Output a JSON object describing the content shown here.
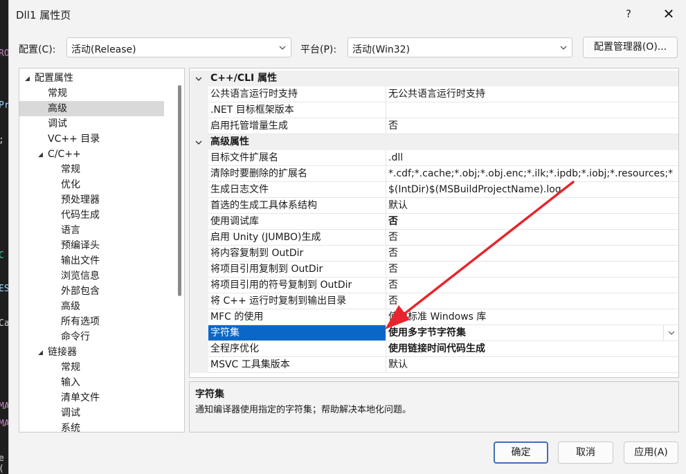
{
  "window": {
    "title": "Dll1 属性页",
    "help": "?",
    "close": "✕"
  },
  "config": {
    "config_label": "配置(C):",
    "config_value": "活动(Release)",
    "platform_label": "平台(P):",
    "platform_value": "活动(Win32)",
    "manager_button": "配置管理器(O)..."
  },
  "tree": [
    {
      "label": "配置属性",
      "level": 0,
      "expanded": true
    },
    {
      "label": "常规",
      "level": 1
    },
    {
      "label": "高级",
      "level": 1,
      "selected": true
    },
    {
      "label": "调试",
      "level": 1
    },
    {
      "label": "VC++ 目录",
      "level": 1
    },
    {
      "label": "C/C++",
      "level": 1,
      "expanded": true
    },
    {
      "label": "常规",
      "level": 2
    },
    {
      "label": "优化",
      "level": 2
    },
    {
      "label": "预处理器",
      "level": 2
    },
    {
      "label": "代码生成",
      "level": 2
    },
    {
      "label": "语言",
      "level": 2
    },
    {
      "label": "预编译头",
      "level": 2
    },
    {
      "label": "输出文件",
      "level": 2
    },
    {
      "label": "浏览信息",
      "level": 2
    },
    {
      "label": "外部包含",
      "level": 2
    },
    {
      "label": "高级",
      "level": 2
    },
    {
      "label": "所有选项",
      "level": 2
    },
    {
      "label": "命令行",
      "level": 2
    },
    {
      "label": "链接器",
      "level": 1,
      "expanded": true
    },
    {
      "label": "常规",
      "level": 2
    },
    {
      "label": "输入",
      "level": 2
    },
    {
      "label": "清单文件",
      "level": 2
    },
    {
      "label": "调试",
      "level": 2
    },
    {
      "label": "系统",
      "level": 2
    }
  ],
  "grid": {
    "categories": [
      {
        "label": "C++/CLI 属性",
        "rows": [
          {
            "name": "公共语言运行时支持",
            "value": "无公共语言运行时支持"
          },
          {
            "name": ".NET 目标框架版本",
            "value": ""
          },
          {
            "name": "启用托管增量生成",
            "value": "否"
          }
        ]
      },
      {
        "label": "高级属性",
        "rows": [
          {
            "name": "目标文件扩展名",
            "value": ".dll"
          },
          {
            "name": "清除时要删除的扩展名",
            "value": "*.cdf;*.cache;*.obj;*.obj.enc;*.ilk;*.ipdb;*.iobj;*.resources;*"
          },
          {
            "name": "生成日志文件",
            "value": "$(IntDir)$(MSBuildProjectName).log"
          },
          {
            "name": "首选的生成工具体系结构",
            "value": "默认"
          },
          {
            "name": "使用调试库",
            "value": "否",
            "bold": true
          },
          {
            "name": "启用 Unity (JUMBO)生成",
            "value": "否"
          },
          {
            "name": "将内容复制到 OutDir",
            "value": "否"
          },
          {
            "name": "将项目引用复制到 OutDir",
            "value": "否"
          },
          {
            "name": "将项目引用的符号复制到 OutDir",
            "value": "否"
          },
          {
            "name": "将 C++ 运行时复制到输出目录",
            "value": "否"
          },
          {
            "name": "MFC 的使用",
            "value": "使用标准 Windows 库"
          },
          {
            "name": "字符集",
            "value": "使用多字节字符集",
            "bold": true,
            "selected": true
          },
          {
            "name": "全程序优化",
            "value": "使用链接时间代码生成",
            "bold": true
          },
          {
            "name": "MSVC 工具集版本",
            "value": "默认"
          }
        ]
      }
    ]
  },
  "description": {
    "title": "字符集",
    "text": "通知编译器使用指定的字符集；帮助解决本地化问题。"
  },
  "buttons": {
    "ok": "确定",
    "cancel": "取消",
    "apply": "应用(A)"
  },
  "colors": {
    "selection": "#0a67c8",
    "arrow": "#e8252c",
    "dialog_bg": "#f3f3f3"
  }
}
